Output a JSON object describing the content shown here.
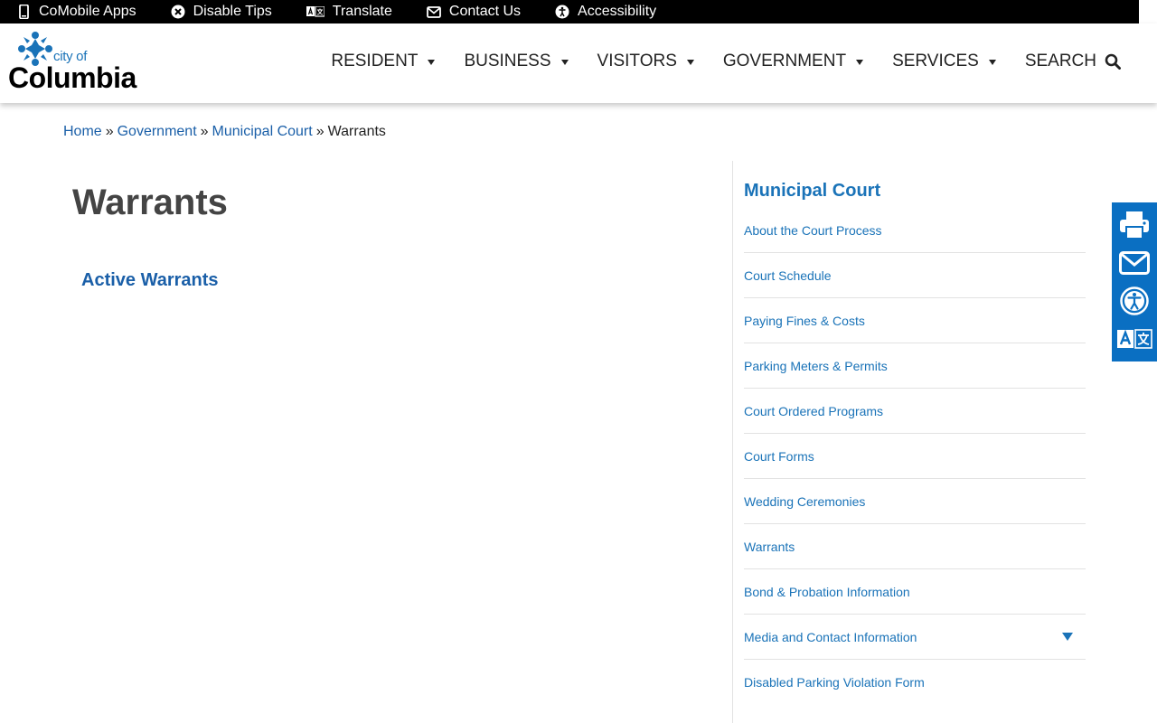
{
  "topbar": {
    "items": [
      {
        "label": "CoMobile Apps",
        "icon": "mobile-phone-icon"
      },
      {
        "label": "Disable Tips",
        "icon": "close-circle-icon"
      },
      {
        "label": "Translate",
        "icon": "translate-icon"
      },
      {
        "label": "Contact Us",
        "icon": "envelope-icon"
      },
      {
        "label": "Accessibility",
        "icon": "accessibility-icon"
      }
    ]
  },
  "logo": {
    "city_of": "city of",
    "name": "Columbia"
  },
  "nav": {
    "items": [
      {
        "label": "RESIDENT"
      },
      {
        "label": "BUSINESS"
      },
      {
        "label": "VISITORS"
      },
      {
        "label": "GOVERNMENT"
      },
      {
        "label": "SERVICES"
      }
    ],
    "search_label": "SEARCH"
  },
  "breadcrumb": {
    "links": [
      "Home",
      "Government",
      "Municipal Court"
    ],
    "separator": "»",
    "current": "Warrants"
  },
  "main": {
    "title": "Warrants",
    "link": "Active Warrants"
  },
  "sidebar": {
    "title": "Municipal Court",
    "items": [
      "About the Court Process",
      "Court Schedule",
      "Paying Fines & Costs",
      "Parking Meters & Permits",
      "Court Ordered Programs",
      "Court Forms",
      "Wedding Ceremonies",
      "Warrants",
      "Bond & Probation Information",
      "Media and Contact Information",
      "Disabled Parking Violation Form"
    ]
  },
  "rail": {
    "icons": [
      "print-icon",
      "email-icon",
      "accessibility-icon",
      "translate-icon"
    ]
  },
  "colors": {
    "link": "#1a5fa8",
    "accent": "#1a73b8",
    "rail": "#0a6fc2",
    "topbar": "#000000"
  }
}
